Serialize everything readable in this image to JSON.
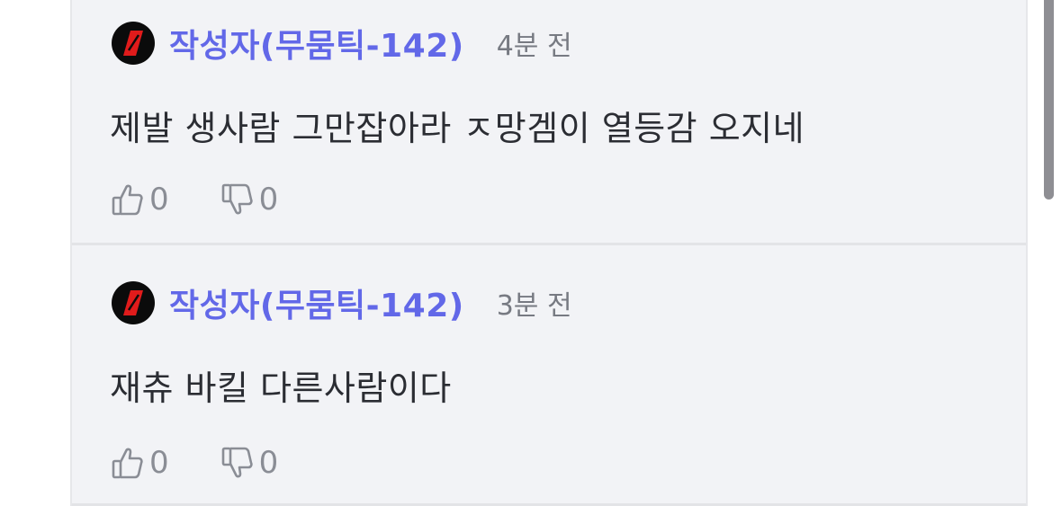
{
  "comments": [
    {
      "author": "작성자(무뭄틱-142)",
      "time": "4분 전",
      "text": "제발 생사람 그만잡아라 ㅈ망겜이 열등감 오지네",
      "likes": "0",
      "dislikes": "0"
    },
    {
      "author": "작성자(무뭄틱-142)",
      "time": "3분 전",
      "text": "재츄 바킬 다른사람이다",
      "likes": "0",
      "dislikes": "0"
    }
  ],
  "icons": {
    "avatar": "red-slash-logo-icon",
    "like": "thumbs-up-icon",
    "dislike": "thumbs-down-icon"
  },
  "colors": {
    "author": "#6268e8",
    "panel": "#f2f3f6",
    "avatar_accent": "#e01b1b"
  }
}
